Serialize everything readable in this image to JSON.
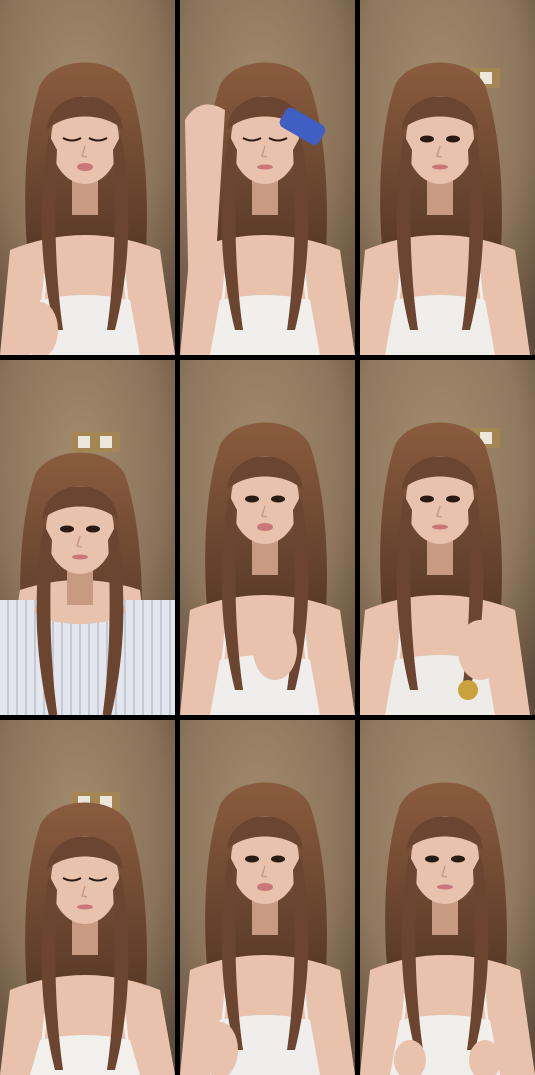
{
  "grid": {
    "rows": 3,
    "cols": 3,
    "tiles": [
      {
        "id": "r1c1",
        "pose": "talking",
        "arm": "right-low",
        "hand_up": false,
        "shirt": "#efeeec",
        "wall": "#8c7459"
      },
      {
        "id": "r1c2",
        "pose": "brushing-hair",
        "arm": "left-up",
        "hand_up": true,
        "shirt": "#f1efec",
        "wall": "#8a7358"
      },
      {
        "id": "r1c3",
        "pose": "looking-right",
        "arm": "none",
        "hand_up": false,
        "shirt": "#f0eeea",
        "wall": "#8e775c"
      },
      {
        "id": "r2c1",
        "pose": "sitting-knees-up",
        "arm": "hands-together",
        "hand_up": false,
        "shirt": "#e3e6ec",
        "wall": "#8b7459"
      },
      {
        "id": "r2c2",
        "pose": "talking-hand-chest",
        "arm": "right-mid",
        "hand_up": false,
        "shirt": "#efeeec",
        "wall": "#8d765b"
      },
      {
        "id": "r2c3",
        "pose": "touching-hair-watch",
        "arm": "left-mid",
        "hand_up": false,
        "shirt": "#eeece8",
        "wall": "#90795e"
      },
      {
        "id": "r3c1",
        "pose": "eyes-closed",
        "arm": "none",
        "hand_up": false,
        "shirt": "#f2f0ec",
        "wall": "#8a7358"
      },
      {
        "id": "r3c2",
        "pose": "talking-gesture",
        "arm": "right-low",
        "hand_up": false,
        "shirt": "#efeeec",
        "wall": "#8c755a"
      },
      {
        "id": "r3c3",
        "pose": "smiling-hands-low",
        "arm": "both-low",
        "hand_up": false,
        "shirt": "#f1efeb",
        "wall": "#8f785d"
      }
    ]
  },
  "colors": {
    "divider": "#000000",
    "hair": "#6b4530",
    "hair_dark": "#3f2719",
    "hair_light": "#8a5c3f",
    "skin": "#e9c2ad",
    "skin_shadow": "#c99a82",
    "lips": "#c9777a",
    "eyes": "#2a1a14",
    "switch_plate": "#a48654",
    "switch": "#ece7dc"
  }
}
